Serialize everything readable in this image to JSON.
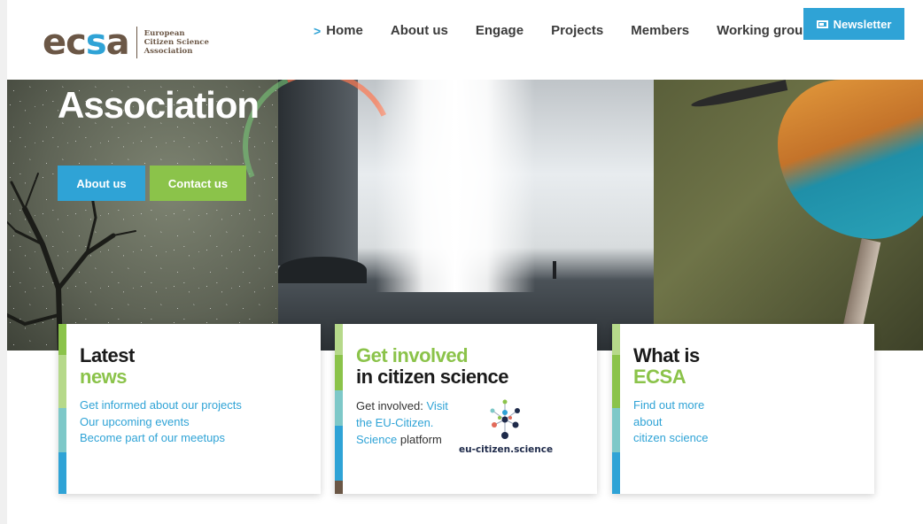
{
  "header": {
    "logo": {
      "word_part1": "ec",
      "word_part2": "s",
      "word_part3": "a",
      "sub_line1": "European",
      "sub_line2": "Citizen Science",
      "sub_line3": "Association"
    },
    "nav": [
      {
        "label": "Home",
        "active": true,
        "icon": "chevron-right-icon"
      },
      {
        "label": "About us"
      },
      {
        "label": "Engage"
      },
      {
        "label": "Projects"
      },
      {
        "label": "Members"
      },
      {
        "label": "Working groups"
      }
    ],
    "newsletter": {
      "label": "Newsletter",
      "icon": "newsletter-icon"
    }
  },
  "hero": {
    "title": "Association",
    "buttons": {
      "about": "About us",
      "contact": "Contact us"
    }
  },
  "cards": {
    "news": {
      "title_dark": "Latest",
      "title_green": "news",
      "links": [
        "Get informed about our projects",
        "Our upcoming events",
        "Become part of our meetups"
      ]
    },
    "involved": {
      "title_green": "Get involved",
      "title_dark": "in citizen science",
      "text_prefix": "Get involved: ",
      "link_text": "Visit the EU-Citizen. Science",
      "text_suffix": " platform",
      "logo_label": "eu-citizen.science"
    },
    "ecsa": {
      "title_dark": "What is",
      "title_green": "ECSA",
      "links": [
        "Find out more",
        "about",
        "citizen science"
      ]
    }
  },
  "colors": {
    "brand_blue": "#2fa3d6",
    "brand_green": "#8bc34a",
    "brand_brown": "#6b5746",
    "accent_teal": "#7ec8c8"
  }
}
